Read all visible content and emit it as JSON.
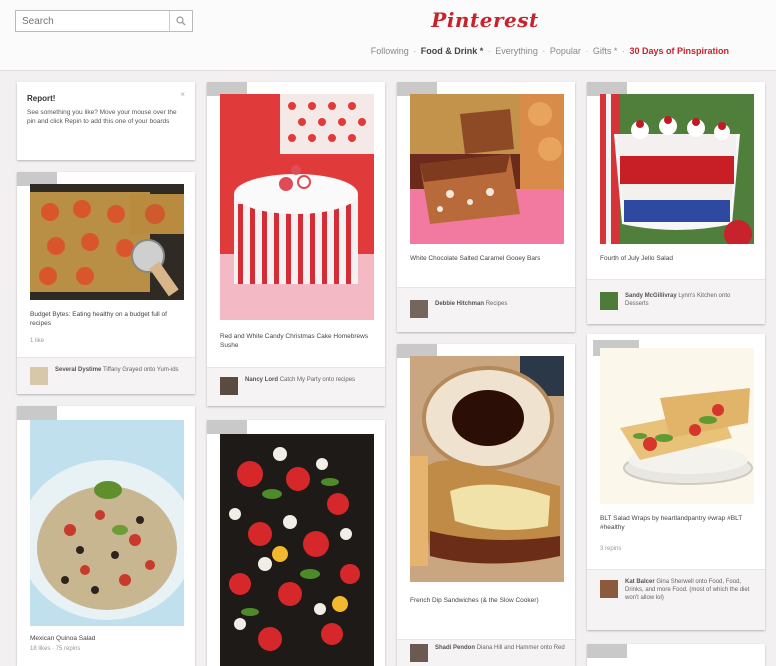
{
  "search": {
    "placeholder": "Search",
    "button_icon": "search-icon"
  },
  "logo": "Pinterest",
  "nav": {
    "following": "Following",
    "food": "Food & Drink *",
    "everything": "Everything",
    "popular": "Popular",
    "gifts": "Gifts *",
    "days": "30 Days of Pinspiration",
    "separator": "·"
  },
  "report": {
    "title": "Report!",
    "body": "See something you like? Move your mouse over the pin and click Repin to add this one of your boards",
    "close": "×"
  },
  "pins": [
    {
      "desc": "Budget Bytes: Eating healthy on a budget full of recipes",
      "meta": "1 like",
      "user": "Several Dystime",
      "board": "Tiffany Grayed onto Yum-ids"
    },
    {
      "desc": "Red and White Candy Christmas Cake Homebrews Sushe",
      "meta": "",
      "user": "Nancy Lord",
      "board": "Catch My Party onto recipes"
    },
    {
      "desc": "White Chocolate Salted Caramel Gooey Bars",
      "meta": "",
      "user": "Debbie Hitchman",
      "board": "Recipes"
    },
    {
      "desc": "Fourth of July Jello Salad",
      "meta": "",
      "user": "Sandy McGillivray",
      "board": "Lynn's Kitchen onto Desserts"
    },
    {
      "desc": "Mexican Quinoa Salad",
      "meta": "18 likes · 75 repins",
      "user": "",
      "board": ""
    },
    {
      "desc": "",
      "meta": "",
      "user": "",
      "board": ""
    },
    {
      "desc": "French Dip Sandwiches (& the Slow Cooker)",
      "meta": "",
      "user": "Shadi Pendon",
      "board": "Diana Hill and Hammer onto Red"
    },
    {
      "desc": "BLT Salad Wraps by heartlandpantry #wrap #BLT #healthy",
      "meta": "3 repins",
      "user": "Kat Balcer",
      "board": "Gina Sherwell onto Food, Food, Drinks, and more Food. (most of which the diet won't allow lol)"
    }
  ],
  "colors": {
    "brand": "#c8232c",
    "background": "#f2f0f0"
  }
}
